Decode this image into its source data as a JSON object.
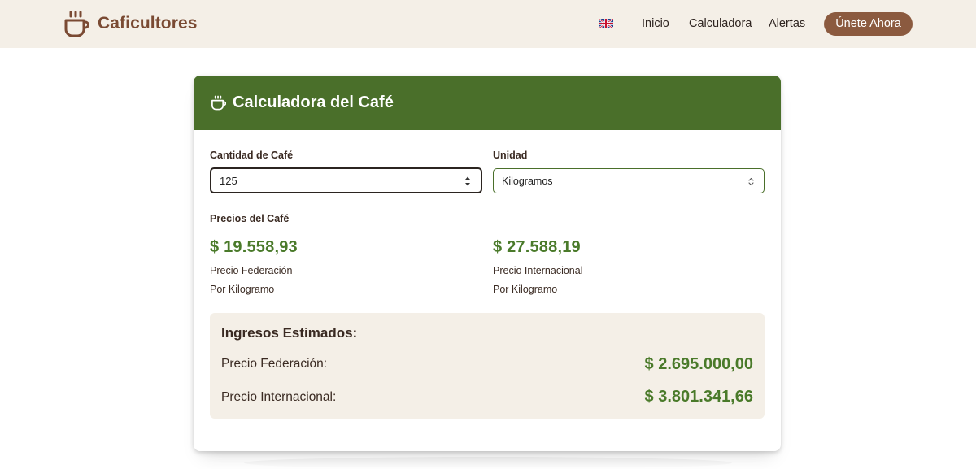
{
  "navbar": {
    "brand_name": "Caficultores",
    "brand_icon": "coffee-cup-icon",
    "language_icon": "uk-flag-icon",
    "links": [
      "Inicio",
      "Calculadora",
      "Alertas"
    ],
    "cta_label": "Únete Ahora"
  },
  "calculator": {
    "title": "Calculadora del Café",
    "title_icon": "coffee-cup-icon",
    "quantity_label": "Cantidad de Café",
    "quantity_value": "125",
    "unit_label": "Unidad",
    "unit_value": "Kilogramos",
    "prices_label": "Precios del Café",
    "federation_price": "$ 19.558,93",
    "federation_label": "Precio Federación",
    "federation_unit": "Por Kilogramo",
    "international_price": "$ 27.588,19",
    "international_label": "Precio Internacional",
    "international_unit": "Por Kilogramo"
  },
  "income": {
    "title": "Ingresos Estimados:",
    "federation_label": "Precio Federación:",
    "federation_value": "$ 2.695.000,00",
    "international_label": "Precio Internacional:",
    "international_value": "$ 3.801.341,66"
  },
  "colors": {
    "brand_brown": "#7a4a33",
    "cta_brown": "#8b5a3f",
    "header_green": "#4a6f2a",
    "price_green": "#4a7a2a",
    "cream": "#f4efe7"
  }
}
